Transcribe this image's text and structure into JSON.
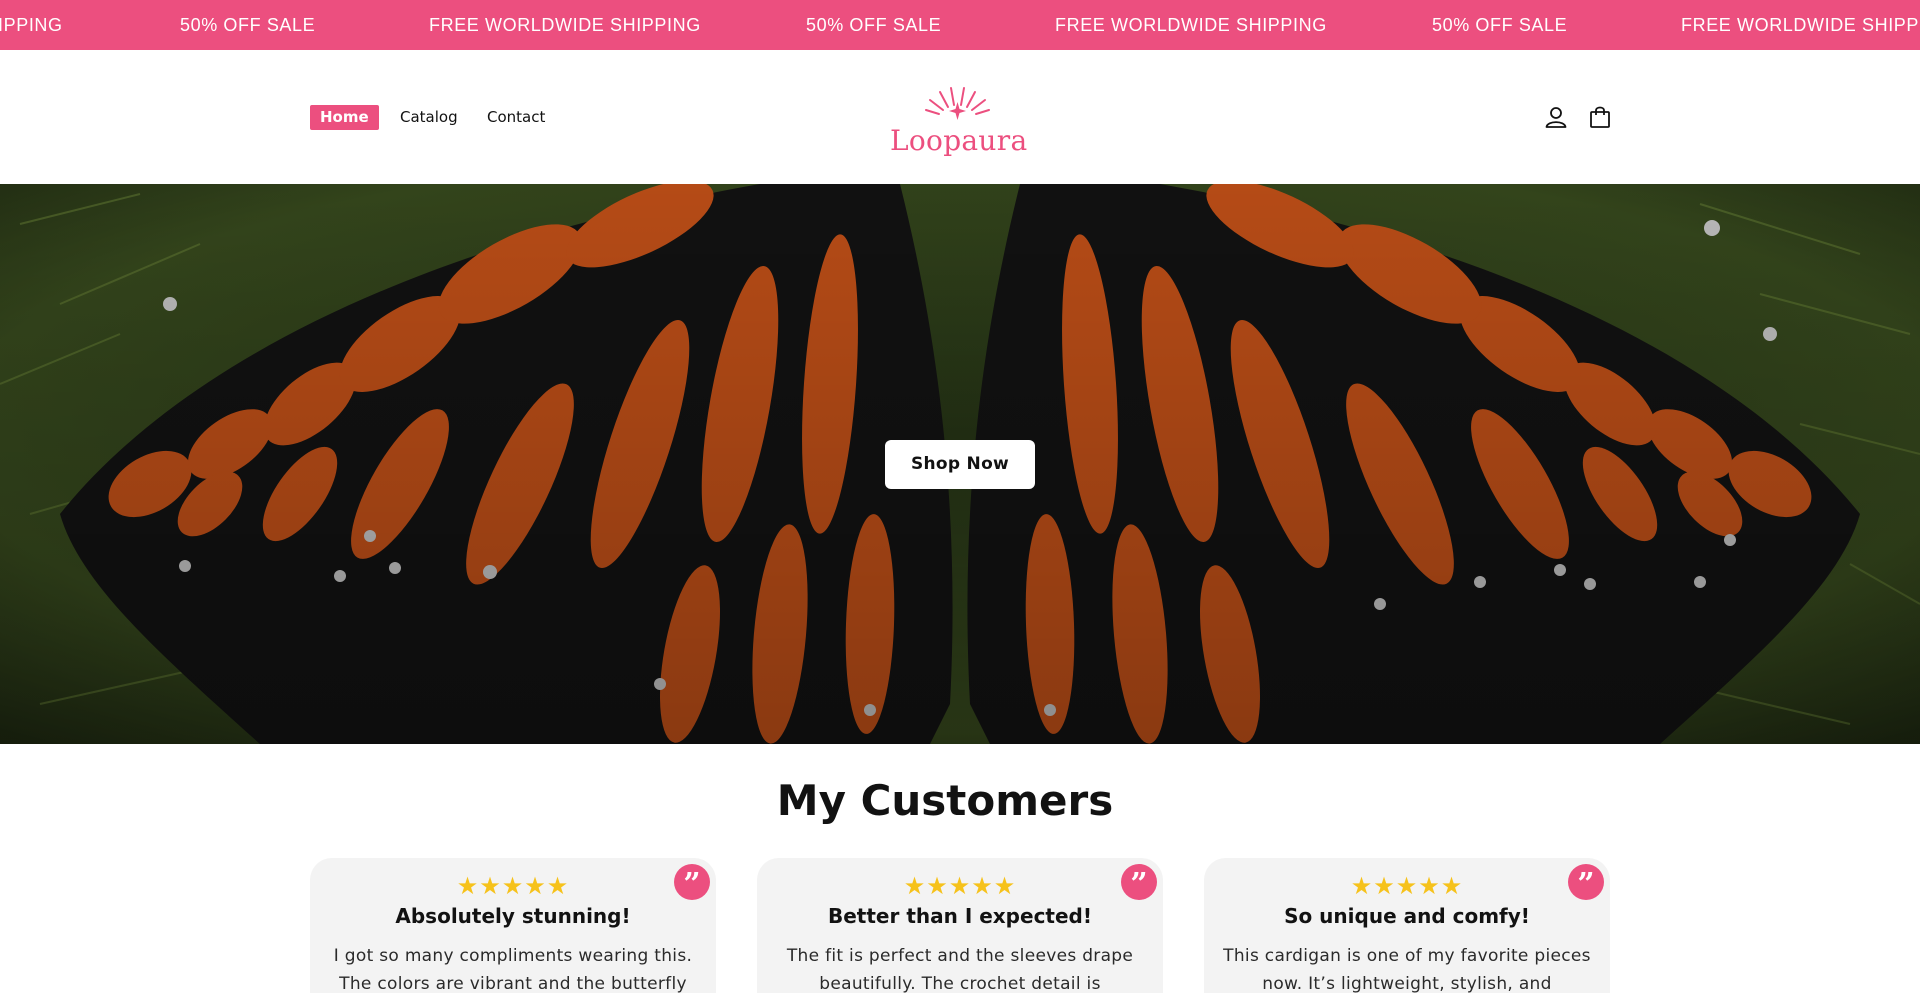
{
  "announcement": {
    "items": [
      "IPPING",
      "50% OFF SALE",
      "FREE WORLDWIDE SHIPPING",
      "50% OFF SALE",
      "FREE WORLDWIDE SHIPPING",
      "50% OFF SALE",
      "FREE WORLDWIDE SHIPPIN"
    ]
  },
  "header": {
    "nav": [
      {
        "label": "Home",
        "active": true
      },
      {
        "label": "Catalog",
        "active": false
      },
      {
        "label": "Contact",
        "active": false
      }
    ],
    "logo_text": "Loopaura",
    "icons": [
      "account-icon",
      "cart-icon"
    ]
  },
  "hero": {
    "button_label": "Shop Now"
  },
  "testimonials": {
    "title": "My Customers",
    "cards": [
      {
        "stars": "★★★★★",
        "title": "Absolutely stunning!",
        "text": "I got so many compliments wearing this. The colors are vibrant and the butterfly"
      },
      {
        "stars": "★★★★★",
        "title": "Better than I expected!",
        "text": "The fit is perfect and the sleeves drape beautifully. The crochet detail is"
      },
      {
        "stars": "★★★★★",
        "title": "So unique and comfy!",
        "text": "This cardigan is one of my favorite pieces now. It’s lightweight, stylish, and"
      }
    ]
  },
  "colors": {
    "brand_pink": "#ec4f7f",
    "star_yellow": "#f6c21b",
    "card_bg": "#f3f3f3"
  }
}
